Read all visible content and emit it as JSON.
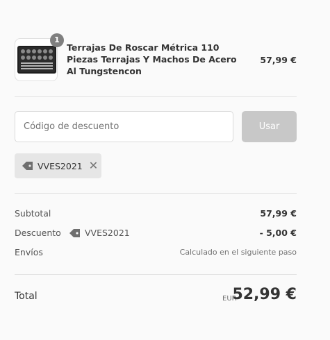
{
  "product": {
    "quantity": "1",
    "title": "Terrajas De Roscar Métrica 110 Piezas Terrajas Y Machos De Acero Al Tungstencon",
    "price": "57,99 €"
  },
  "discount": {
    "placeholder": "Código de descuento",
    "apply_label": "Usar",
    "applied_code": "VVES2021",
    "remove_symbol": "✕"
  },
  "summary": {
    "subtotal_label": "Subtotal",
    "subtotal_value": "57,99 €",
    "discount_label": "Descuento",
    "discount_code": "VVES2021",
    "discount_value": "- 5,00 €",
    "shipping_label": "Envíos",
    "shipping_value": "Calculado en el siguiente paso"
  },
  "total": {
    "label": "Total",
    "currency": "EUR",
    "value": "52,99 €"
  },
  "colors": {
    "button_disabled": "#c8c8c8",
    "tag_bg": "#e6e6e6",
    "badge_bg": "#7f7f7f"
  }
}
